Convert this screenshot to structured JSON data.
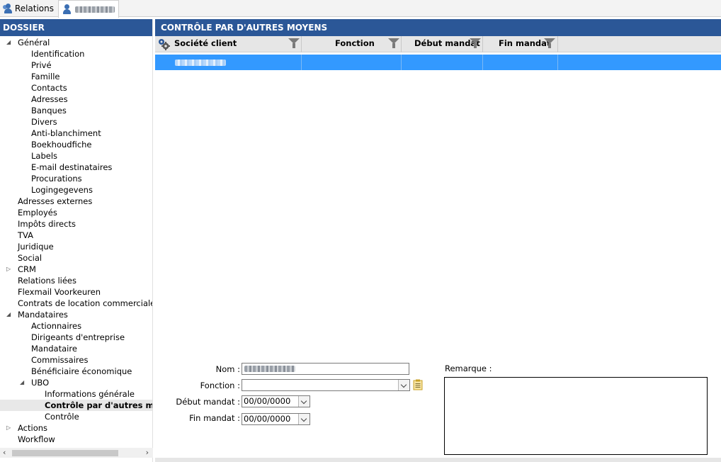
{
  "tabs": [
    {
      "label": "Relations",
      "icon": "users-icon"
    },
    {
      "label": "",
      "icon": "user-icon"
    }
  ],
  "sidebar": {
    "title": "DOSSIER",
    "items": [
      {
        "label": "Général",
        "level": 0,
        "expanded": true
      },
      {
        "label": "Identification",
        "level": 1
      },
      {
        "label": "Privé",
        "level": 1
      },
      {
        "label": "Famille",
        "level": 1
      },
      {
        "label": "Contacts",
        "level": 1
      },
      {
        "label": "Adresses",
        "level": 1
      },
      {
        "label": "Banques",
        "level": 1
      },
      {
        "label": "Divers",
        "level": 1
      },
      {
        "label": "Anti-blanchiment",
        "level": 1
      },
      {
        "label": "Boekhoudfiche",
        "level": 1
      },
      {
        "label": "Labels",
        "level": 1
      },
      {
        "label": "E-mail destinataires",
        "level": 1
      },
      {
        "label": "Procurations",
        "level": 1
      },
      {
        "label": "Logingegevens",
        "level": 1
      },
      {
        "label": "Adresses externes",
        "level": 0
      },
      {
        "label": "Employés",
        "level": 0
      },
      {
        "label": "Impôts directs",
        "level": 0
      },
      {
        "label": "TVA",
        "level": 0
      },
      {
        "label": "Juridique",
        "level": 0
      },
      {
        "label": "Social",
        "level": 0
      },
      {
        "label": "CRM",
        "level": 0,
        "collapsed": true
      },
      {
        "label": "Relations liées",
        "level": 0
      },
      {
        "label": "Flexmail Voorkeuren",
        "level": 0
      },
      {
        "label": "Contrats de location commerciale",
        "level": 0
      },
      {
        "label": "Mandataires",
        "level": 0,
        "expanded": true
      },
      {
        "label": "Actionnaires",
        "level": 1
      },
      {
        "label": "Dirigeants d'entreprise",
        "level": 1
      },
      {
        "label": "Mandataire",
        "level": 1
      },
      {
        "label": "Commissaires",
        "level": 1
      },
      {
        "label": "Bénéficiaire économique",
        "level": 1
      },
      {
        "label": "UBO",
        "level": 1,
        "expanded": true
      },
      {
        "label": "Informations générale",
        "level": 2
      },
      {
        "label": "Contrôle par d'autres m",
        "level": 2,
        "selected": true
      },
      {
        "label": "Contrôle",
        "level": 2
      },
      {
        "label": "Actions",
        "level": 0,
        "collapsed": true
      },
      {
        "label": "Workflow",
        "level": 0
      }
    ]
  },
  "main": {
    "title": "CONTRÔLE PAR D'AUTRES MOYENS",
    "grid": {
      "columns": [
        "Société client",
        "Fonction",
        "Début mandat",
        "Fin mandat"
      ],
      "rows": [
        {
          "societe": "",
          "fonction": "",
          "debut": "",
          "fin": ""
        }
      ],
      "selected_row_color": "#3399ff"
    },
    "form": {
      "nom_label": "Nom :",
      "nom_value": "",
      "fonction_label": "Fonction :",
      "fonction_value": "",
      "debut_label": "Début mandat :",
      "debut_value": "00/00/0000",
      "fin_label": "Fin mandat :",
      "fin_value": "00/00/0000",
      "remarque_label": "Remarque :"
    }
  },
  "colors": {
    "header_bg": "#2b5797",
    "selection": "#3399ff"
  }
}
